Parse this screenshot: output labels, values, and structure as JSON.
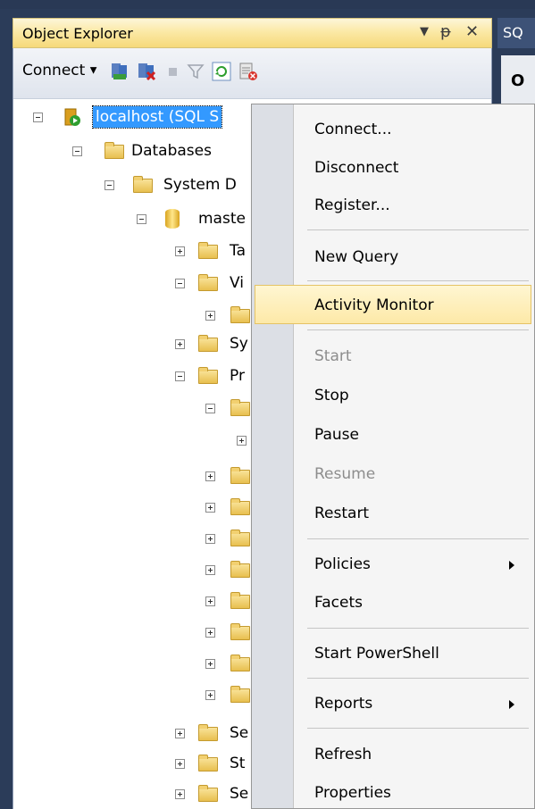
{
  "object_explorer": {
    "title": "Object Explorer",
    "toolbar": {
      "connect_label": "Connect"
    }
  },
  "document_tab": {
    "label": "SQ",
    "sub_label": "O"
  },
  "tree": {
    "server_label": "localhost (SQL S",
    "databases_label": "Databases",
    "system_databases_label": "System D",
    "master_label": "maste",
    "tables_label": "Ta",
    "views_label": "Vi",
    "synonyms_label": "Sy",
    "programmability_label": "Pr",
    "service_broker_label": "Se",
    "storage_label": "St",
    "security_label": "Se"
  },
  "context_menu": {
    "items": [
      {
        "label": "Connect...",
        "enabled": true
      },
      {
        "label": "Disconnect",
        "enabled": true
      },
      {
        "label": "Register...",
        "enabled": true
      },
      {
        "label": "New Query",
        "enabled": true
      },
      {
        "label": "Activity Monitor",
        "enabled": true,
        "highlighted": true
      },
      {
        "label": "Start",
        "enabled": false
      },
      {
        "label": "Stop",
        "enabled": true
      },
      {
        "label": "Pause",
        "enabled": true
      },
      {
        "label": "Resume",
        "enabled": false
      },
      {
        "label": "Restart",
        "enabled": true
      },
      {
        "label": "Policies",
        "enabled": true,
        "submenu": true
      },
      {
        "label": "Facets",
        "enabled": true
      },
      {
        "label": "Start PowerShell",
        "enabled": true
      },
      {
        "label": "Reports",
        "enabled": true,
        "submenu": true
      },
      {
        "label": "Refresh",
        "enabled": true
      },
      {
        "label": "Properties",
        "enabled": true
      }
    ]
  },
  "colors": {
    "selection": "#3399ff",
    "menu_highlight": "#fde9a8",
    "title_bar": "#fbe9a6",
    "frame": "#2b3c59"
  }
}
